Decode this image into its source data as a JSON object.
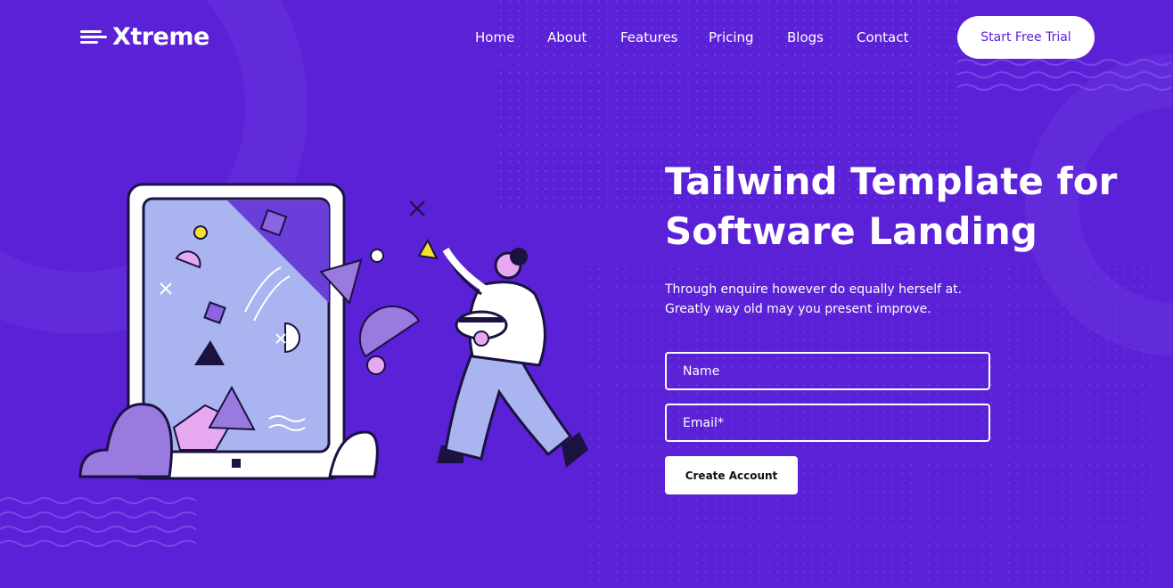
{
  "brand": {
    "name": "Xtreme",
    "icon": "speed-lines-icon"
  },
  "nav": {
    "items": [
      {
        "label": "Home"
      },
      {
        "label": "About"
      },
      {
        "label": "Features"
      },
      {
        "label": "Pricing"
      },
      {
        "label": "Blogs"
      },
      {
        "label": "Contact"
      }
    ],
    "cta_label": "Start Free Trial"
  },
  "hero": {
    "title_line1": "Tailwind Template for",
    "title_line2": "Software Landing",
    "subtitle_line1": "Through enquire however do equally herself at.",
    "subtitle_line2": "Greatly way old may you present improve.",
    "form": {
      "name_placeholder": "Name",
      "email_placeholder": "Email*",
      "submit_label": "Create Account"
    }
  },
  "colors": {
    "background": "#5b21d6",
    "accent_light": "#a9b4f0",
    "accent_purple": "#9b7ae0",
    "text": "#ffffff"
  }
}
